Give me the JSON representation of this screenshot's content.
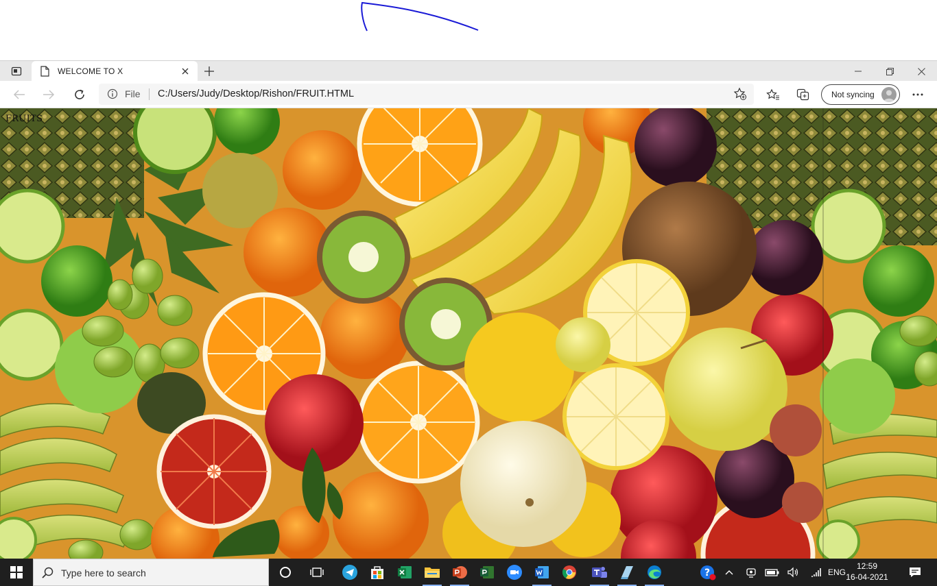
{
  "browser": {
    "tab_title": "WELCOME TO X",
    "address_scheme_label": "File",
    "address_url": "C:/Users/Judy/Desktop/Rishon/FRUIT.HTML",
    "sync_label": "Not syncing"
  },
  "page": {
    "heading": "FRUITS"
  },
  "taskbar": {
    "search_placeholder": "Type here to search",
    "language": "ENG",
    "time": "12:59",
    "date": "16-04-2021",
    "apps": [
      "task-view",
      "telegram",
      "store",
      "excel",
      "file-explorer",
      "powerpoint",
      "project",
      "zoom",
      "word",
      "chrome",
      "teams",
      "notes",
      "edge"
    ]
  },
  "colors": {
    "tabstrip": "#e8e8e8",
    "taskbar": "#1f1f1f",
    "accent_underline": "#8ab4f8"
  }
}
